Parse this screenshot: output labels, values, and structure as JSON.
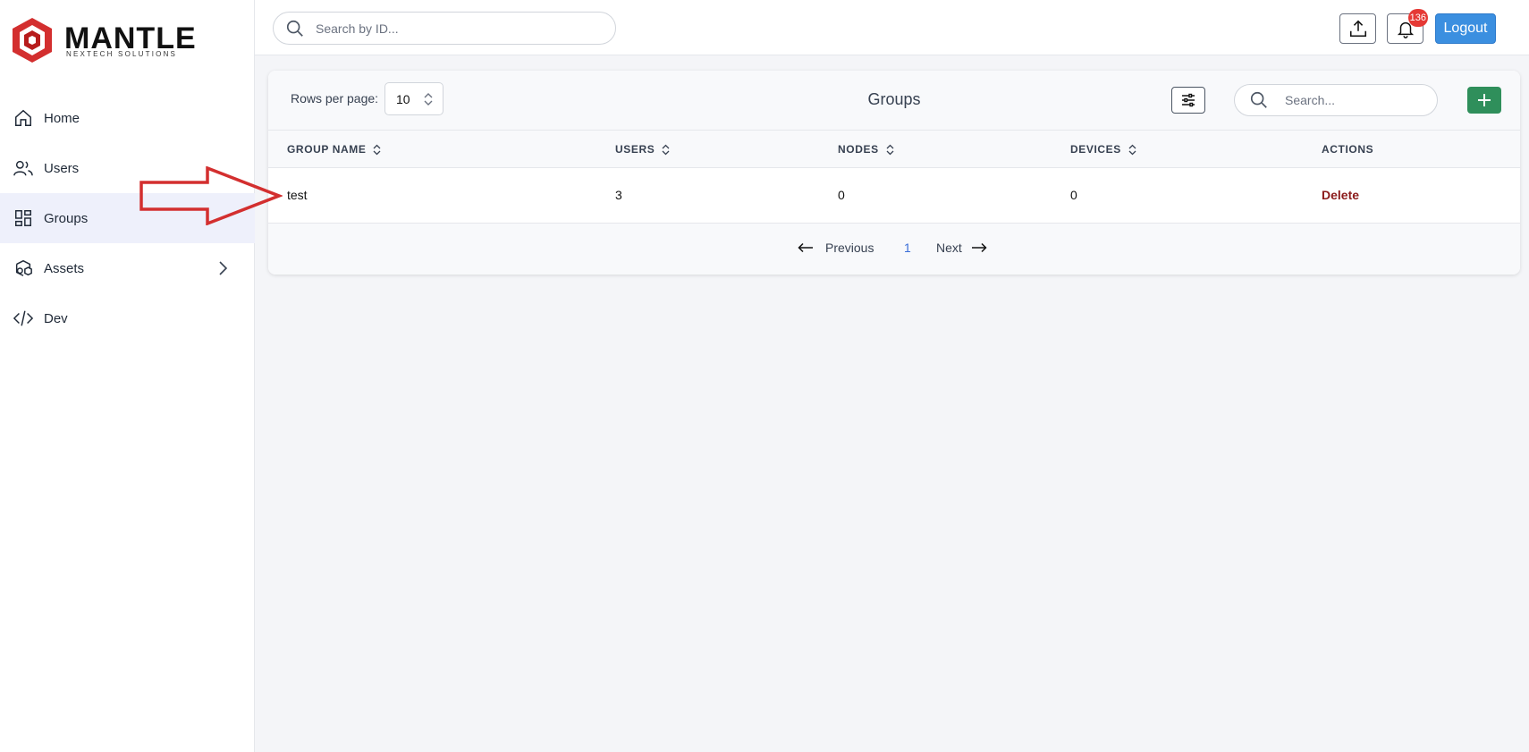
{
  "brand": {
    "name": "MANTLE",
    "tagline": "NEXTECH SOLUTIONS",
    "accent": "#d32f2f"
  },
  "sidebar": {
    "items": [
      {
        "label": "Home",
        "icon": "home-icon",
        "active": false
      },
      {
        "label": "Users",
        "icon": "users-icon",
        "active": false
      },
      {
        "label": "Groups",
        "icon": "groups-icon",
        "active": true
      },
      {
        "label": "Assets",
        "icon": "assets-icon",
        "active": false,
        "expandable": true
      },
      {
        "label": "Dev",
        "icon": "code-icon",
        "active": false
      }
    ]
  },
  "topbar": {
    "search_placeholder": "Search by ID...",
    "notifications_count": "136",
    "logout_label": "Logout"
  },
  "card": {
    "rows_per_page_label": "Rows per page:",
    "rows_per_page_value": "10",
    "title": "Groups",
    "search_placeholder": "Search...",
    "add_label": "+"
  },
  "table": {
    "columns": [
      "GROUP NAME",
      "USERS",
      "NODES",
      "DEVICES",
      "ACTIONS"
    ],
    "rows": [
      {
        "group_name": "test",
        "users": "3",
        "nodes": "0",
        "devices": "0",
        "action": "Delete"
      }
    ]
  },
  "pagination": {
    "previous_label": "Previous",
    "current_page": "1",
    "next_label": "Next"
  },
  "colors": {
    "primary": "#3b8fe0",
    "success": "#2f8f5b",
    "danger_text": "#8b1a1a",
    "annotation": "#d32f2f"
  }
}
